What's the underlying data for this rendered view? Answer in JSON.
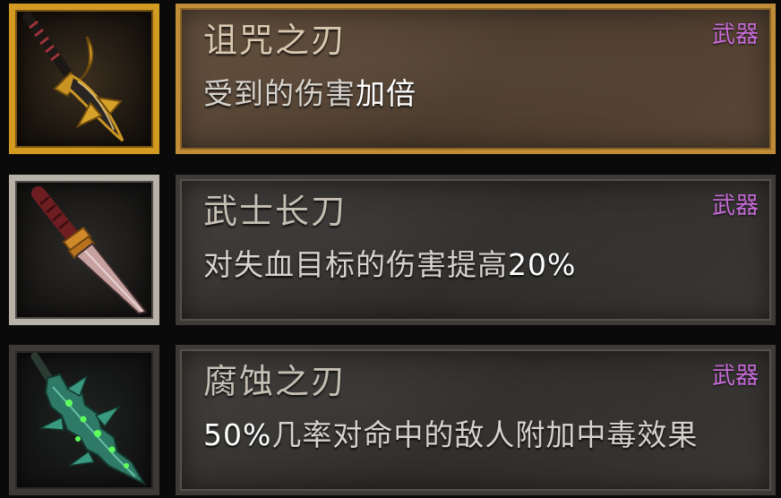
{
  "items": [
    {
      "name": "诅咒之刃",
      "type": "武器",
      "desc_prefix": "受到的伤害",
      "desc_highlight": "加倍",
      "icon": "cursed-golden-blade-icon",
      "frame_color": "#d29a21"
    },
    {
      "name": "武士长刀",
      "type": "武器",
      "desc_prefix": "对失血目标的伤害提高",
      "desc_highlight": "20%",
      "icon": "katana-icon",
      "frame_color": "#b8b3a9"
    },
    {
      "name": "腐蚀之刃",
      "type": "武器",
      "desc_prefix": "",
      "desc_highlight": "50%",
      "desc_suffix": "几率对命中的敌人附加中毒效果",
      "icon": "corrosive-jade-blade-icon",
      "frame_color": "#3d3a36"
    }
  ],
  "colors": {
    "type_label": "#c56bd6",
    "title_text": "#c5bfb4",
    "desc_text": "#d6d3cd"
  }
}
